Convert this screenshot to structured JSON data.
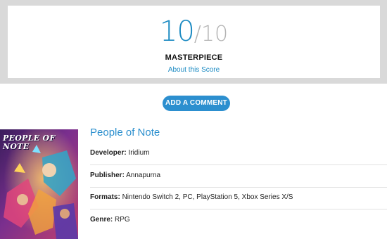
{
  "review": {
    "score": "10",
    "slash": "/",
    "max": "10",
    "verdict": "MASTERPIECE",
    "about_link": "About this Score"
  },
  "comment_button": "ADD A COMMENT",
  "game": {
    "title": "People of Note",
    "cover_logo": "PEOPLE OF NOTE",
    "details": [
      {
        "label": "Developer:",
        "value": "Iridium"
      },
      {
        "label": "Publisher:",
        "value": "Annapurna"
      },
      {
        "label": "Formats:",
        "value": "Nintendo Switch 2, PC, PlayStation 5, Xbox Series X/S"
      },
      {
        "label": "Genre:",
        "value": "RPG"
      }
    ]
  },
  "colors": {
    "accent": "#1b8ac2",
    "button": "#2c8fcf",
    "band": "#d9d9d9",
    "muted": "#b4b4b4"
  }
}
